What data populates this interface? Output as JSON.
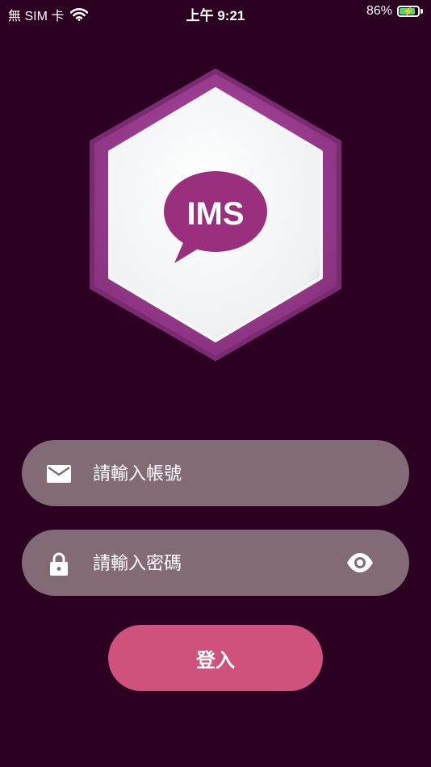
{
  "status_bar": {
    "carrier": "無 SIM 卡",
    "time": "上午 9:21",
    "battery_percent": "86%",
    "battery_level": 0.86
  },
  "logo": {
    "text": "IMS",
    "outer_color": "#9a3a8e",
    "inner_color": "#f5f5f5",
    "bubble_color": "#9a2f7e"
  },
  "form": {
    "account_placeholder": "請輸入帳號",
    "password_placeholder": "請輸入密碼",
    "login_label": "登入"
  },
  "colors": {
    "background": "#2b0021",
    "field": "#836a77",
    "button": "#cf527d"
  },
  "icons": {
    "account": "mail-icon",
    "password": "lock-icon",
    "toggle": "eye-icon"
  }
}
